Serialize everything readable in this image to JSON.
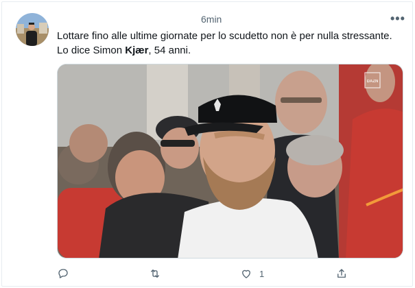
{
  "tweet": {
    "time": "6min",
    "more_label": "•••",
    "text_before": "Lottare fino alle ultime giornate per lo scudetto non è per nulla stressante. Lo dice Simon ",
    "text_bold": "Kjær",
    "text_after": ", 54 anni.",
    "media": {
      "watermark": "DAZN"
    },
    "actions": {
      "reply": {
        "count": ""
      },
      "retweet": {
        "count": ""
      },
      "like": {
        "count": "1"
      },
      "share": {
        "count": ""
      }
    }
  },
  "colors": {
    "text": "#0f1419",
    "muted": "#536471",
    "border": "#e6ecf0"
  }
}
